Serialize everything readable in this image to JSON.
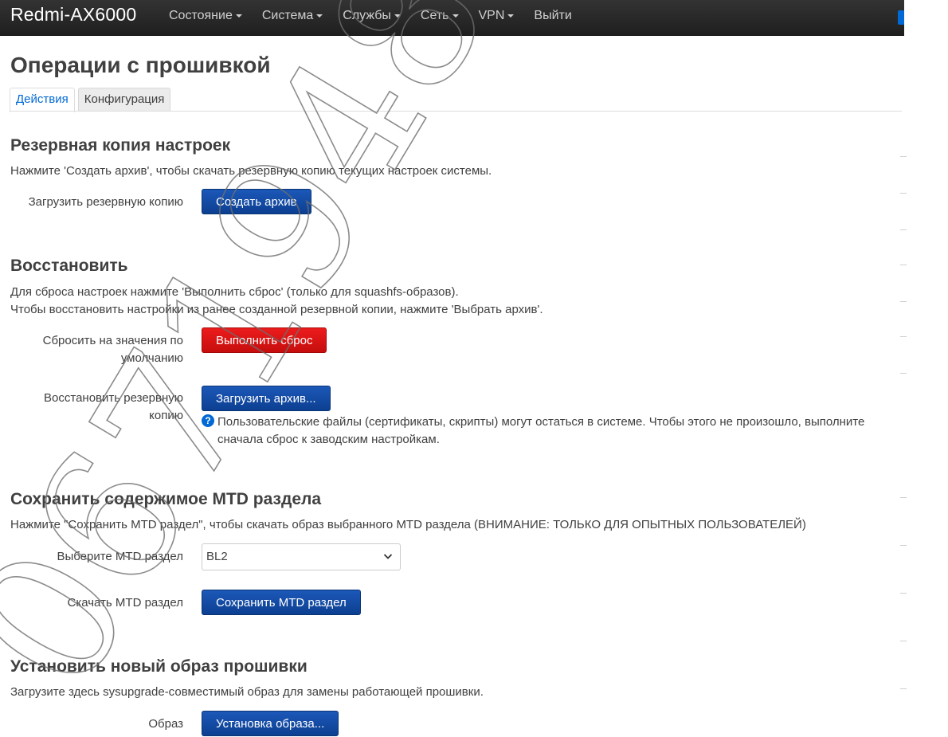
{
  "navbar": {
    "brand": "Redmi-AX6000",
    "menu": [
      "Состояние",
      "Система",
      "Службы",
      "Сеть",
      "VPN",
      "Выйти"
    ]
  },
  "page": {
    "title": "Операции с прошивкой",
    "tabs": [
      "Действия",
      "Конфигурация"
    ]
  },
  "backup": {
    "title": "Резервная копия настроек",
    "desc": "Нажмите 'Создать архив', чтобы скачать резервную копию текущих настроек системы.",
    "label": "Загрузить резервную копию",
    "button": "Создать архив"
  },
  "restore": {
    "title": "Восстановить",
    "desc1": "Для сброса настроек нажмите 'Выполнить сброс' (только для squashfs-образов).",
    "desc2": "Чтобы восстановить настройки из ранее созданной резервной копии, нажмите 'Выбрать архив'.",
    "reset_label_1": "Сбросить на значения по",
    "reset_label_2": "умолчанию",
    "reset_button": "Выполнить сброс",
    "restore_label_1": "Восстановить резервную",
    "restore_label_2": "копию",
    "upload_button": "Загрузить архив...",
    "help_1": "Пользовательские файлы (сертификаты, скрипты) могут остаться в системе. Чтобы этого не произошло, выполните",
    "help_2": "сначала сброс к заводским настройкам."
  },
  "mtd": {
    "title": "Сохранить содержимое MTD раздела",
    "desc": "Нажмите \"Сохранить MTD раздел\", чтобы скачать образ выбранного MTD раздела (ВНИМАНИЕ: ТОЛЬКО ДЛЯ ОПЫТНЫХ ПОЛЬЗОВАТЕЛЕЙ)",
    "select_label": "Выберите MTD раздел",
    "select_value": "BL2",
    "download_label": "Скачать MTD раздел",
    "button": "Сохранить MTD раздел"
  },
  "flash": {
    "title": "Установить новый образ прошивки",
    "desc": "Загрузите здесь sysupgrade-совместимый образ для замены работающей прошивки.",
    "image_label": "Образ",
    "button": "Установка образа..."
  },
  "watermark": {
    "text": "0671948508"
  },
  "colors": {
    "navbar": "#222222",
    "primary_button": "#0c3f91",
    "danger_button": "#d61212",
    "link": "#0069d6"
  }
}
